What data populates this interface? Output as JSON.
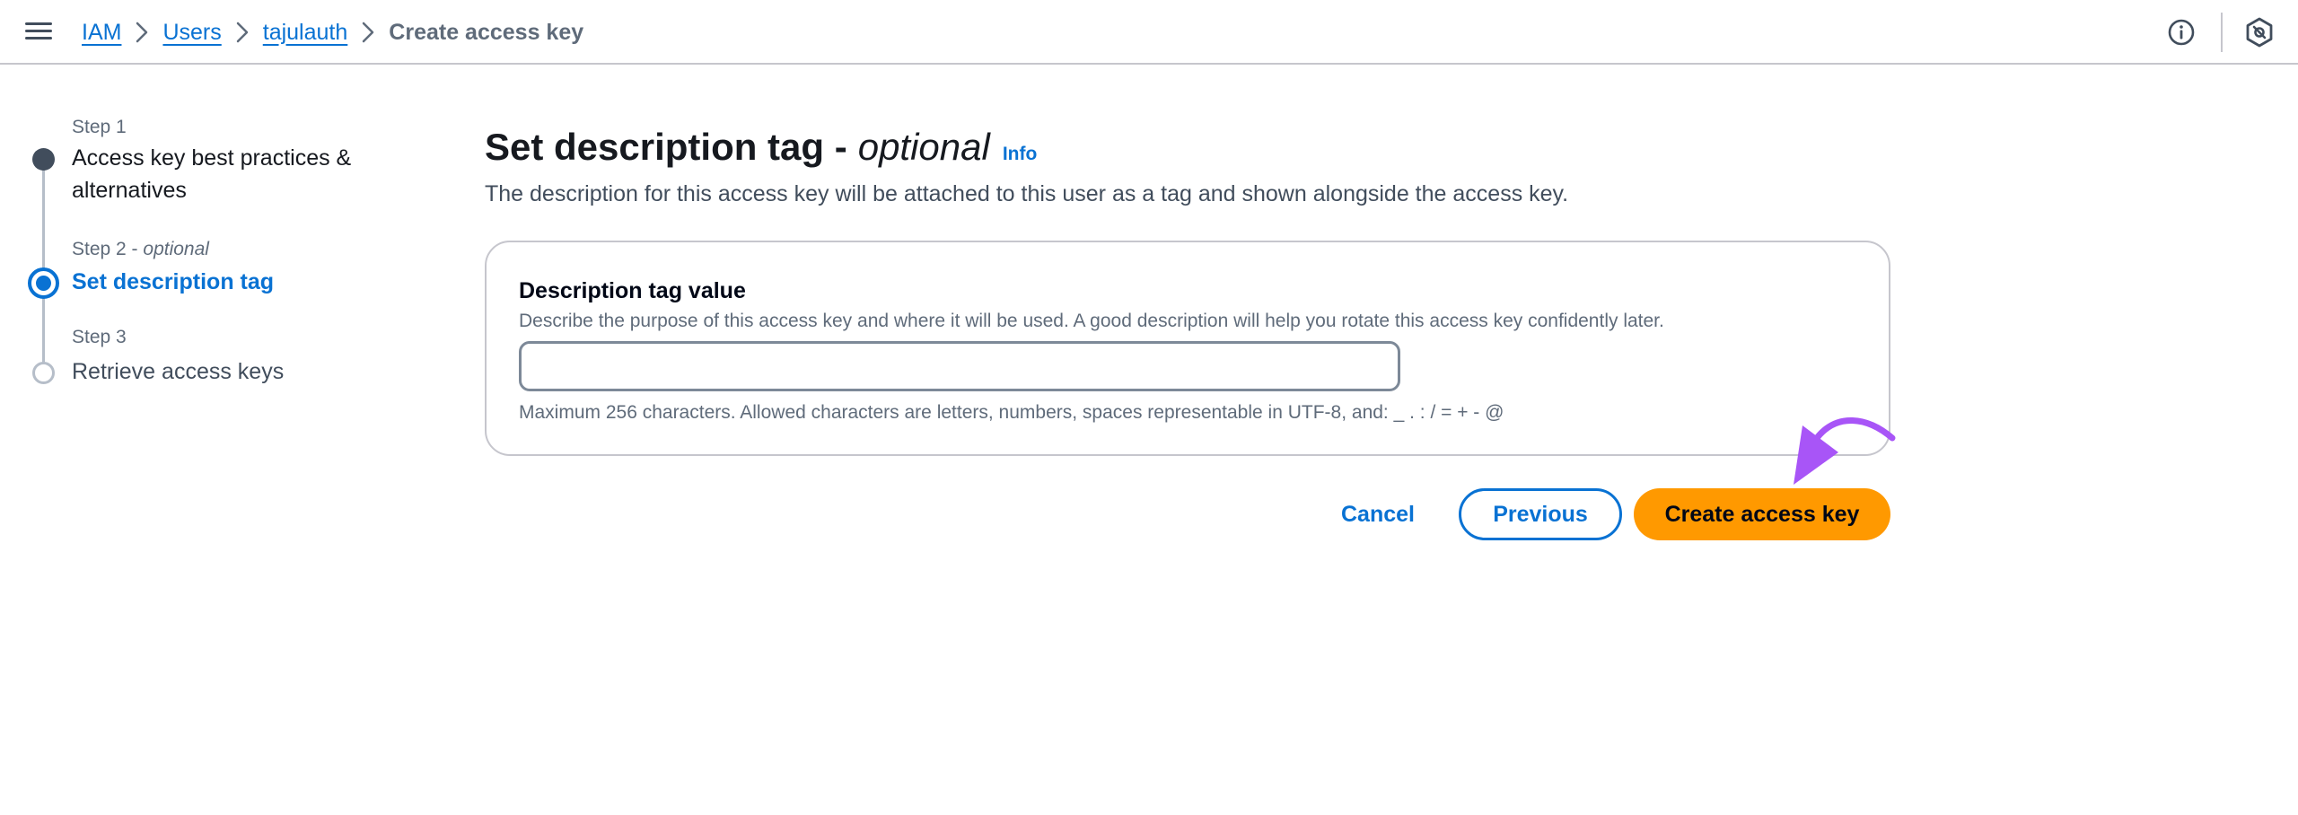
{
  "breadcrumb": {
    "items": [
      "IAM",
      "Users",
      "tajulauth"
    ],
    "current": "Create access key"
  },
  "topbar": {
    "menu_icon": "hamburger-menu-icon",
    "help_icon": "info-circle-icon",
    "settings_icon": "hexagon-settings-icon"
  },
  "steps": [
    {
      "number": "Step 1",
      "optional": "",
      "title_line1": "Access key best practices &",
      "title_line2": "alternatives",
      "state": "completed"
    },
    {
      "number": "Step 2",
      "optional": "optional",
      "title_line1": "Set description tag",
      "title_line2": "",
      "state": "active"
    },
    {
      "number": "Step 3",
      "optional": "",
      "title_line1": "Retrieve access keys",
      "title_line2": "",
      "state": "pending"
    }
  ],
  "main": {
    "title": "Set description tag -",
    "title_optional": "optional",
    "info_link": "Info",
    "subtitle": "The description for this access key will be attached to this user as a tag and shown alongside the access key."
  },
  "form": {
    "label": "Description tag value",
    "description": "Describe the purpose of this access key and where it will be used. A good description will help you rotate this access key confidently later.",
    "value": "",
    "hint": "Maximum 256 characters. Allowed characters are letters, numbers, spaces representable in UTF-8, and: _ . : / = + - @"
  },
  "actions": {
    "cancel": "Cancel",
    "previous": "Previous",
    "create": "Create access key"
  },
  "colors": {
    "link": "#0972d3",
    "primary_button": "#ff9900",
    "annotation_arrow": "#a855f7",
    "completed_dot": "#414d5c"
  }
}
